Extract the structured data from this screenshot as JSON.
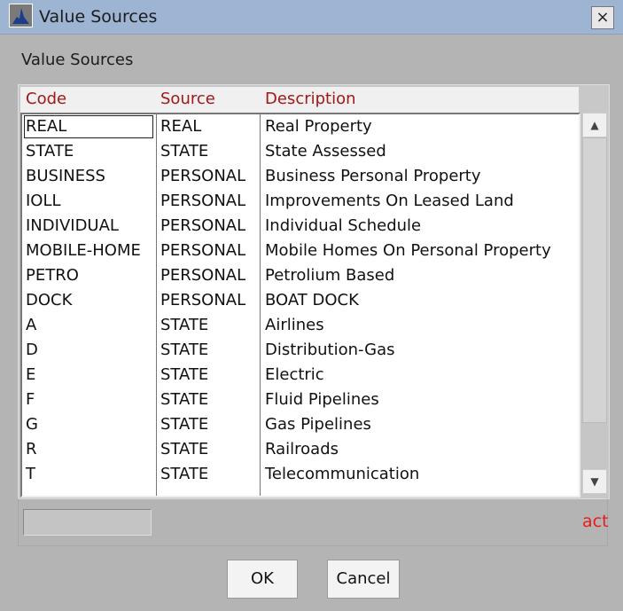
{
  "window": {
    "title": "Value Sources",
    "close_label": "×"
  },
  "panel_label": "Value Sources",
  "table": {
    "headers": [
      "Code",
      "Source",
      "Description"
    ],
    "rows": [
      [
        "REAL",
        "REAL",
        "Real Property"
      ],
      [
        "STATE",
        "STATE",
        "State Assessed"
      ],
      [
        "BUSINESS",
        "PERSONAL",
        "Business Personal Property"
      ],
      [
        "IOLL",
        "PERSONAL",
        "Improvements On Leased Land"
      ],
      [
        "INDIVIDUAL",
        "PERSONAL",
        "Individual Schedule"
      ],
      [
        "MOBILE-HOME",
        "PERSONAL",
        "Mobile Homes On Personal Property"
      ],
      [
        "PETRO",
        "PERSONAL",
        "Petrolium Based"
      ],
      [
        "DOCK",
        "PERSONAL",
        "BOAT DOCK"
      ],
      [
        "A",
        "STATE",
        "Airlines"
      ],
      [
        "D",
        "STATE",
        "Distribution-Gas"
      ],
      [
        "E",
        "STATE",
        "Electric"
      ],
      [
        "F",
        "STATE",
        "Fluid Pipelines"
      ],
      [
        "G",
        "STATE",
        "Gas Pipelines"
      ],
      [
        "R",
        "STATE",
        "Railroads"
      ],
      [
        "T",
        "STATE",
        "Telecommunication"
      ]
    ]
  },
  "status_text": "act",
  "buttons": {
    "ok": "OK",
    "cancel": "Cancel"
  },
  "scroll": {
    "up": "▲",
    "down": "▼"
  },
  "colors": {
    "header_text": "#a01818",
    "status": "#e81c1c",
    "titlebar": "#9db5d3"
  }
}
